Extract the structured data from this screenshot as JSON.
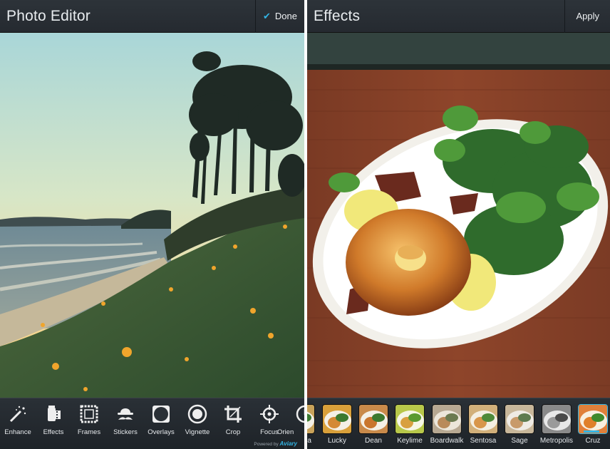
{
  "left": {
    "title": "Photo Editor",
    "done_label": "Done",
    "tools": [
      {
        "label": "Enhance",
        "icon": "magic-wand-icon"
      },
      {
        "label": "Effects",
        "icon": "film-canister-icon"
      },
      {
        "label": "Frames",
        "icon": "frame-icon"
      },
      {
        "label": "Stickers",
        "icon": "hat-mustache-icon"
      },
      {
        "label": "Overlays",
        "icon": "overlay-icon"
      },
      {
        "label": "Vignette",
        "icon": "vignette-icon"
      },
      {
        "label": "Crop",
        "icon": "crop-icon"
      },
      {
        "label": "Focus",
        "icon": "focus-icon"
      },
      {
        "label": "Orien",
        "icon": "orientation-icon"
      }
    ],
    "powered_prefix": "Powered by",
    "powered_brand": "Aviary"
  },
  "right": {
    "title": "Effects",
    "apply_label": "Apply",
    "effects": [
      {
        "label": "na",
        "tint": "#c9a35a"
      },
      {
        "label": "Lucky",
        "tint": "#d9a03a"
      },
      {
        "label": "Dean",
        "tint": "#c98a4a"
      },
      {
        "label": "Keylime",
        "tint": "#b8c84a"
      },
      {
        "label": "Boardwalk",
        "tint": "#b7a892"
      },
      {
        "label": "Sentosa",
        "tint": "#d2b07a"
      },
      {
        "label": "Sage",
        "tint": "#c8b79a"
      },
      {
        "label": "Metropolis",
        "tint": "#8a8a8a"
      },
      {
        "label": "Cruz",
        "tint": "#e0803a"
      }
    ],
    "selected_effect": "Cruz"
  },
  "colors": {
    "accent": "#33b5e5",
    "bar": "#252a30"
  }
}
